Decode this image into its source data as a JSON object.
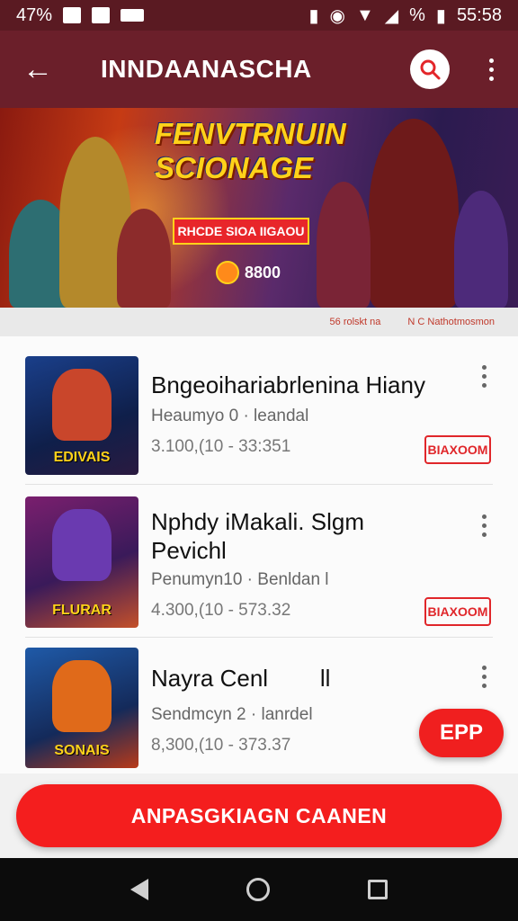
{
  "status_bar": {
    "battery_text": "47%",
    "right_percent": "%",
    "time": "55:58"
  },
  "app_bar": {
    "title": "INNDAANASCHA"
  },
  "banner": {
    "title": "FENVTRNUIN SCIONAGE",
    "ribbon_text": "RHCDE SIOA IIGAOU",
    "coin_value": "8800"
  },
  "sub_strip": {
    "left_text": "56 rolskt na",
    "right_text": "N C Nathotmosmon"
  },
  "games": [
    {
      "title": "Bngeoihariabrlenina Hiany",
      "subtitle": "Heaumyo 0 · leandal",
      "meta": "3.100,(10 - 33:351",
      "badge": "BIAXOOM",
      "thumb_label": "EDIVAIS"
    },
    {
      "title": "Nphdy iMakali. Slgm Pevichl",
      "subtitle": "Penumyn10 · Benldan l",
      "meta": "4.300,(10 - 573.32",
      "badge": "BIAXOOM",
      "thumb_label": "FLURAR"
    },
    {
      "title": "Nayra Cenl        ll",
      "subtitle": "Sendmcyn 2 · lanrdel",
      "meta": "8,300,(10 - 373.37",
      "badge": "",
      "thumb_label": "SONAIS"
    }
  ],
  "fab_label": "EPP",
  "cta_label": "ANPASGKIAGN CAANEN",
  "colors": {
    "accent": "#f41e1e",
    "app_bar": "#6b1f2a",
    "status_bar": "#5a1a22"
  }
}
